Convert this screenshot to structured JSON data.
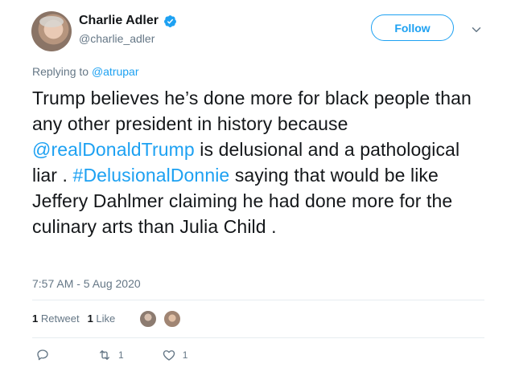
{
  "author": {
    "name": "Charlie Adler",
    "handle": "@charlie_adler",
    "verified": true
  },
  "follow_label": "Follow",
  "reply": {
    "prefix": "Replying to",
    "to": "@atrupar"
  },
  "tweet": {
    "seg1": "Trump believes he’s done more for black people than any other president in history because ",
    "mention": "@realDonaldTrump",
    "seg2": " is delusional and a pathological liar . ",
    "hashtag": "#DelusionalDonnie",
    "seg3": " saying that would be like Jeffery Dahlmer claiming he had done more for the culinary arts than Julia Child ."
  },
  "timestamp": "7:57 AM - 5 Aug 2020",
  "stats": {
    "retweets_count": "1",
    "retweets_label": "Retweet",
    "likes_count": "1",
    "likes_label": "Like"
  },
  "actions": {
    "reply_icon": "comment-icon",
    "retweet_icon": "retweet-icon",
    "retweet_count": "1",
    "like_icon": "heart-icon",
    "like_count": "1"
  },
  "colors": {
    "accent": "#1da1f2",
    "text": "#14171a",
    "muted": "#657786",
    "divider": "#e6ecf0"
  }
}
